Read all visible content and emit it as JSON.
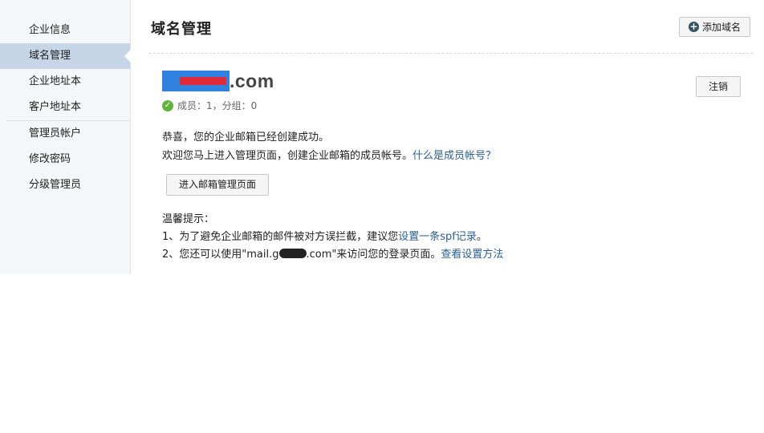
{
  "sidebar": {
    "items": [
      {
        "label": "企业信息"
      },
      {
        "label": "域名管理"
      },
      {
        "label": "企业地址本"
      },
      {
        "label": "客户地址本"
      }
    ],
    "items2": [
      {
        "label": "管理员帐户"
      },
      {
        "label": "修改密码"
      },
      {
        "label": "分级管理员"
      }
    ]
  },
  "header": {
    "title": "域名管理",
    "add_domain_label": "添加域名"
  },
  "domain": {
    "name_suffix": ".com",
    "logout_label": "注销",
    "stats": "成员：1，分组：0"
  },
  "messages": {
    "line1": "恭喜，您的企业邮箱已经创建成功。",
    "line2_text": "欢迎您马上进入管理页面，创建企业邮箱的成员帐号。",
    "line2_link": "什么是成员帐号？",
    "enter_button": "进入邮箱管理页面"
  },
  "tips": {
    "title": "温馨提示：",
    "tip1_text": "1、为了避免企业邮箱的邮件被对方误拦截，建议您",
    "tip1_link": "设置一条spf记录",
    "tip1_end": "。",
    "tip2_prefix": "2、您还可以使用\"mail.g",
    "tip2_suffix": ".com\"来访问您的登录页面。",
    "tip2_link": "查看设置方法"
  },
  "colors": {
    "link": "#2a5f95",
    "sidebar_bg": "#f4f6f9",
    "active_item": "#c7d6e6"
  }
}
